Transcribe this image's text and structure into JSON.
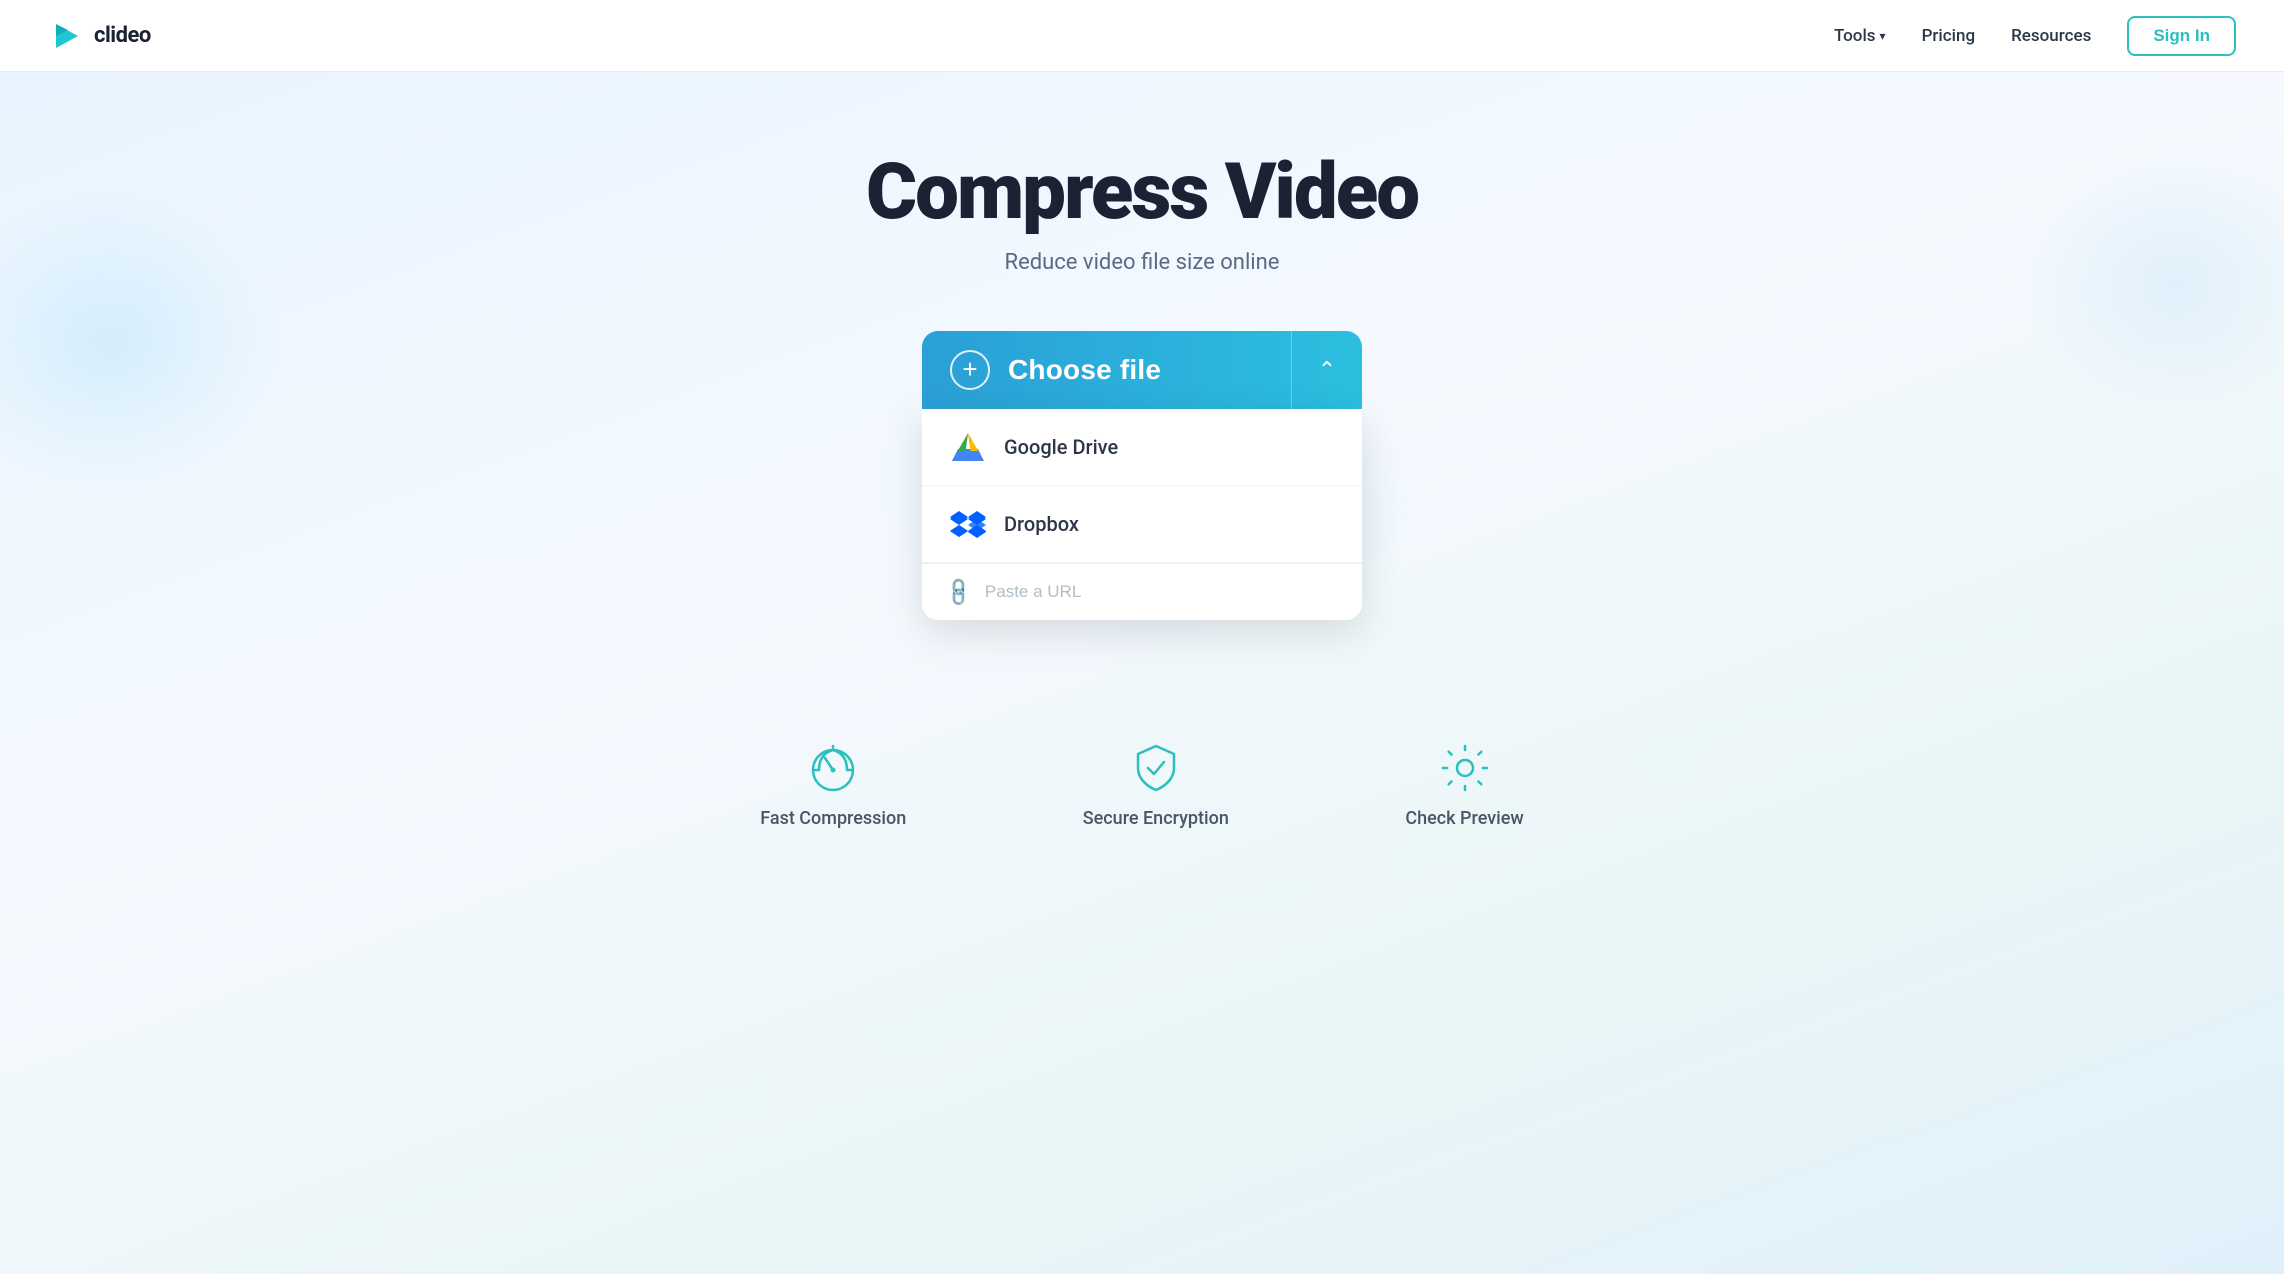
{
  "header": {
    "logo_text": "clideo",
    "nav": {
      "tools_label": "Tools",
      "pricing_label": "Pricing",
      "resources_label": "Resources",
      "sign_in_label": "Sign In"
    }
  },
  "main": {
    "title": "Compress Video",
    "subtitle": "Reduce video file size online",
    "upload": {
      "choose_file_label": "Choose file",
      "google_drive_label": "Google Drive",
      "dropbox_label": "Dropbox",
      "url_placeholder": "Paste a URL"
    }
  },
  "features": [
    {
      "label": "Fast Compression",
      "icon": "speedometer-icon"
    },
    {
      "label": "Secure Encryption",
      "icon": "shield-icon"
    },
    {
      "label": "Check Preview",
      "icon": "gear-icon"
    }
  ]
}
